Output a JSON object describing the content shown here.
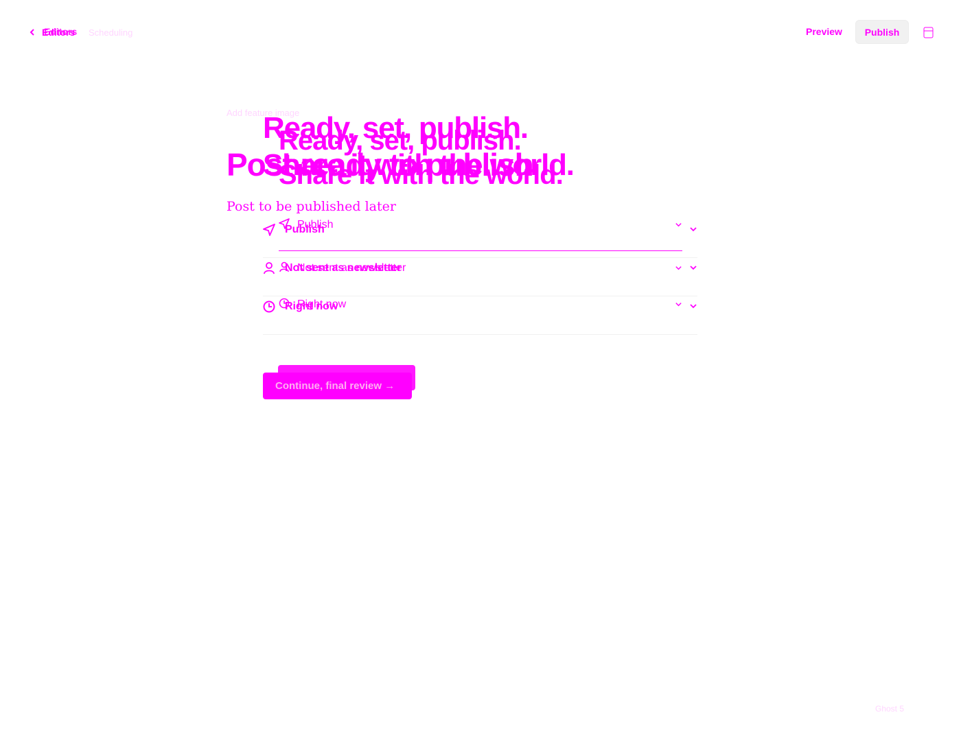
{
  "header": {
    "back_label": "Editors",
    "status": "Scheduling",
    "preview_label": "Preview",
    "publish_label": "Publish",
    "settings_icon": "sidebar-toggle-icon"
  },
  "editor": {
    "feature_image_label": "Add feature image",
    "title": "Post ready to publish",
    "body": "Post to be published later"
  },
  "publish_flow": {
    "heading_line1": "Ready, set, publish.",
    "heading_line2": "Share it with the world.",
    "options": [
      {
        "label": "Publish",
        "icon": "send-icon"
      },
      {
        "label": "Not sent as newsletter",
        "icon": "user-icon"
      },
      {
        "label": "Right now",
        "icon": "clock-icon"
      }
    ],
    "continue_label": "Continue, final review →"
  },
  "footer": {
    "credit": "Ghost 5"
  },
  "colors": {
    "accent": "#ff00ff",
    "muted": "#ffd6ff",
    "button_bg": "#f1f1f1"
  }
}
